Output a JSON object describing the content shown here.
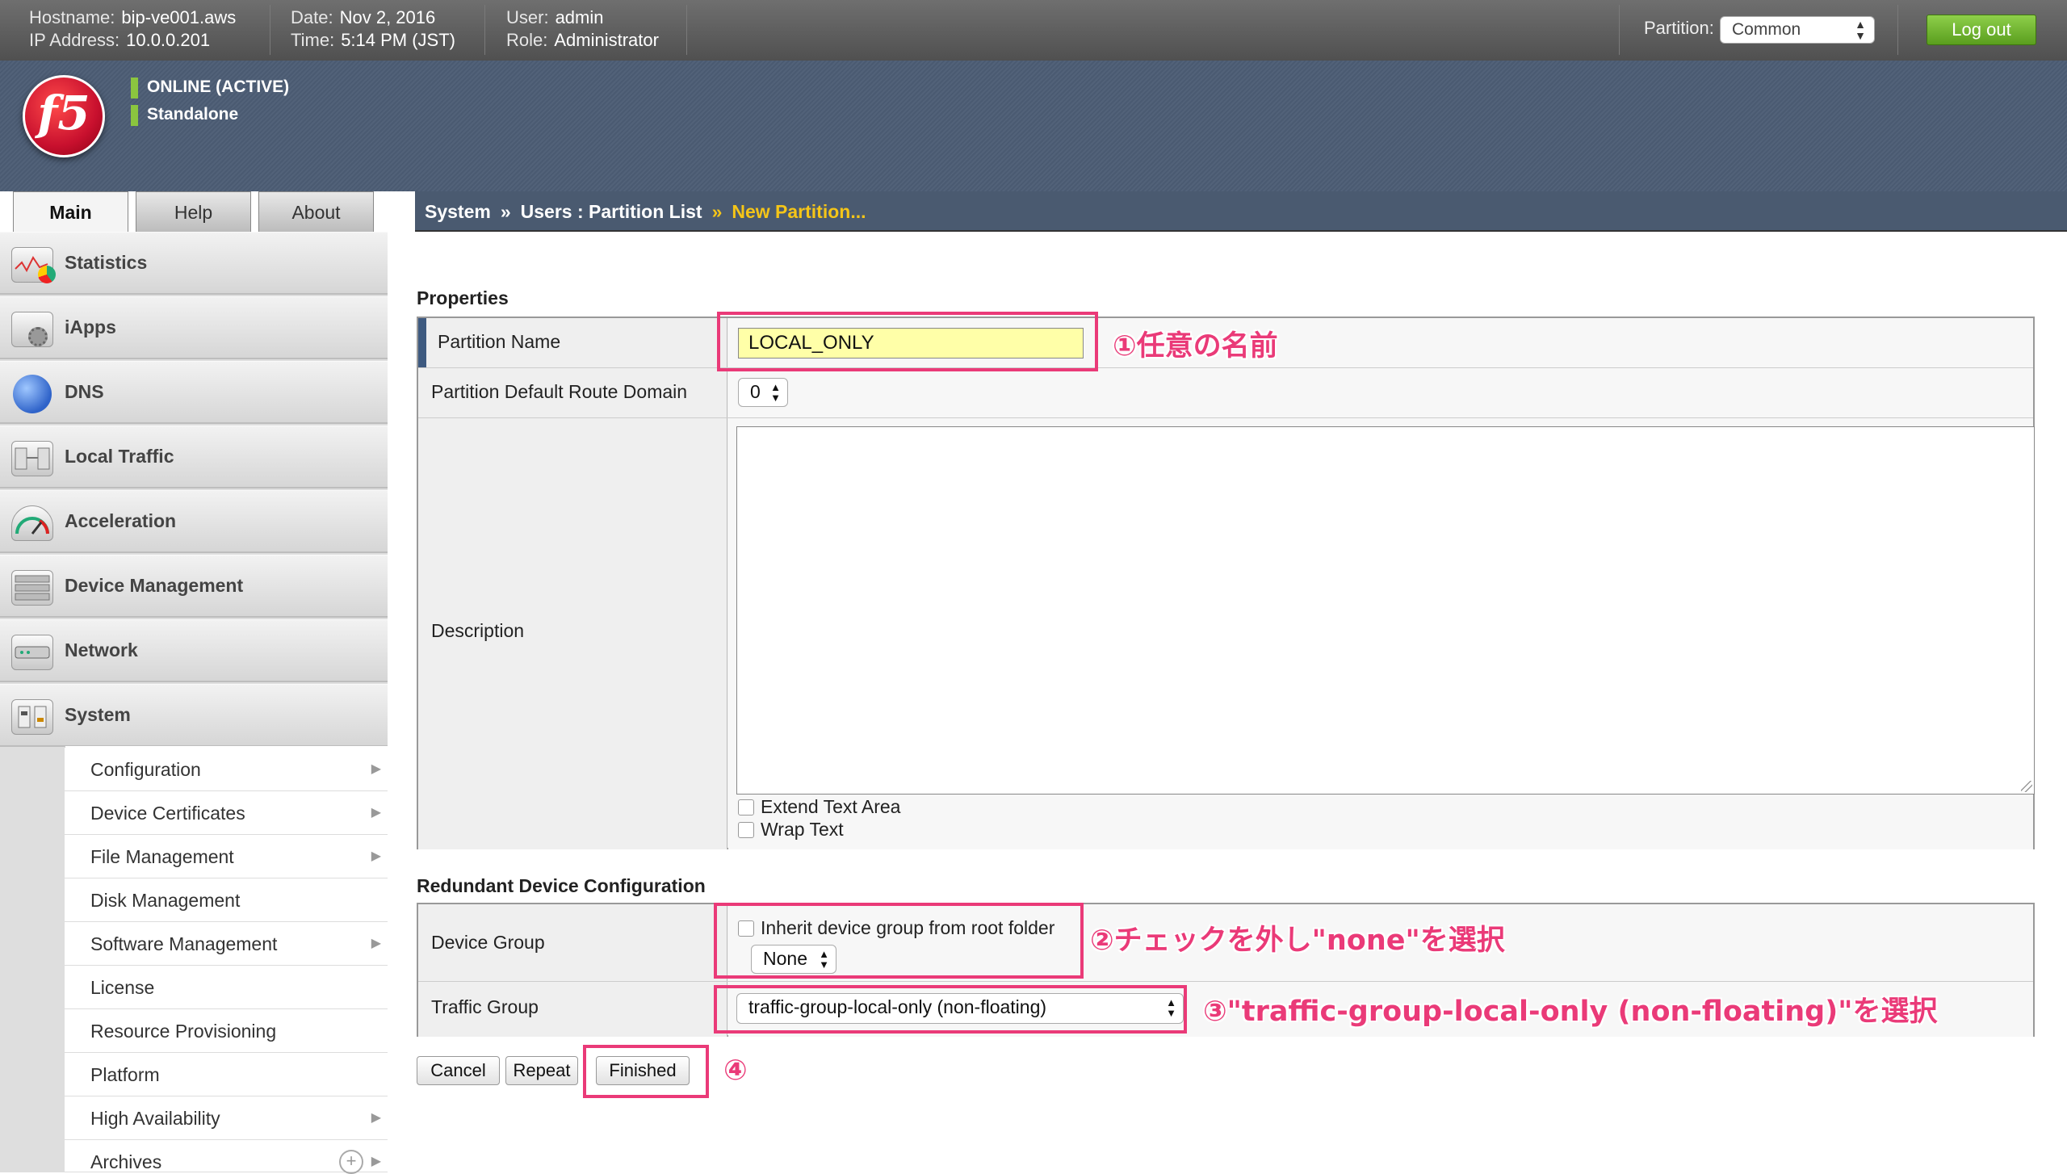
{
  "topbar": {
    "hostname_label": "Hostname:",
    "hostname": "bip-ve001.aws",
    "ip_label": "IP Address:",
    "ip": "10.0.0.201",
    "date_label": "Date:",
    "date": "Nov 2, 2016",
    "time_label": "Time:",
    "time": "5:14 PM (JST)",
    "user_label": "User:",
    "user": "admin",
    "role_label": "Role:",
    "role": "Administrator",
    "partition_label": "Partition:",
    "partition_value": "Common",
    "logout_label": "Log out"
  },
  "status": {
    "line1": "ONLINE (ACTIVE)",
    "line2": "Standalone",
    "color": "#8bc53f"
  },
  "logo_text": "f5",
  "tabs": [
    {
      "label": "Main"
    },
    {
      "label": "Help"
    },
    {
      "label": "About"
    }
  ],
  "breadcrumb": {
    "part1": "System",
    "sep": "»",
    "part2": "Users : Partition List",
    "current": "New Partition..."
  },
  "sidebar": {
    "items": [
      {
        "label": "Statistics",
        "icon": "statistics-icon"
      },
      {
        "label": "iApps",
        "icon": "iapps-icon"
      },
      {
        "label": "DNS",
        "icon": "dns-globe-icon"
      },
      {
        "label": "Local Traffic",
        "icon": "local-traffic-icon"
      },
      {
        "label": "Acceleration",
        "icon": "acceleration-gauge-icon"
      },
      {
        "label": "Device Management",
        "icon": "device-management-icon"
      },
      {
        "label": "Network",
        "icon": "network-icon"
      },
      {
        "label": "System",
        "icon": "system-icon"
      }
    ],
    "subitems": [
      {
        "label": "Configuration"
      },
      {
        "label": "Device Certificates"
      },
      {
        "label": "File Management"
      },
      {
        "label": "Disk Management"
      },
      {
        "label": "Software Management"
      },
      {
        "label": "License"
      },
      {
        "label": "Resource Provisioning"
      },
      {
        "label": "Platform"
      },
      {
        "label": "High Availability"
      },
      {
        "label": "Archives"
      }
    ]
  },
  "properties": {
    "title": "Properties",
    "partition_name_label": "Partition Name",
    "partition_name_value": "LOCAL_ONLY",
    "route_domain_label": "Partition Default Route Domain",
    "route_domain_value": "0",
    "description_label": "Description",
    "description_value": "",
    "extend_text_area": "Extend Text Area",
    "wrap_text": "Wrap Text"
  },
  "redundant": {
    "title": "Redundant Device Configuration",
    "device_group_label": "Device Group",
    "inherit_label": "Inherit device group from root folder",
    "device_group_value": "None",
    "traffic_group_label": "Traffic Group",
    "traffic_group_value": "traffic-group-local-only (non-floating)"
  },
  "buttons": {
    "cancel": "Cancel",
    "repeat": "Repeat",
    "finished": "Finished"
  },
  "annotations": {
    "a1": "①任意の名前",
    "a2": "②チェックを外し\"none\"を選択",
    "a3": "③\"traffic-group-local-only (non-floating)\"を選択",
    "a4": "④",
    "color": "#ea3a78"
  }
}
